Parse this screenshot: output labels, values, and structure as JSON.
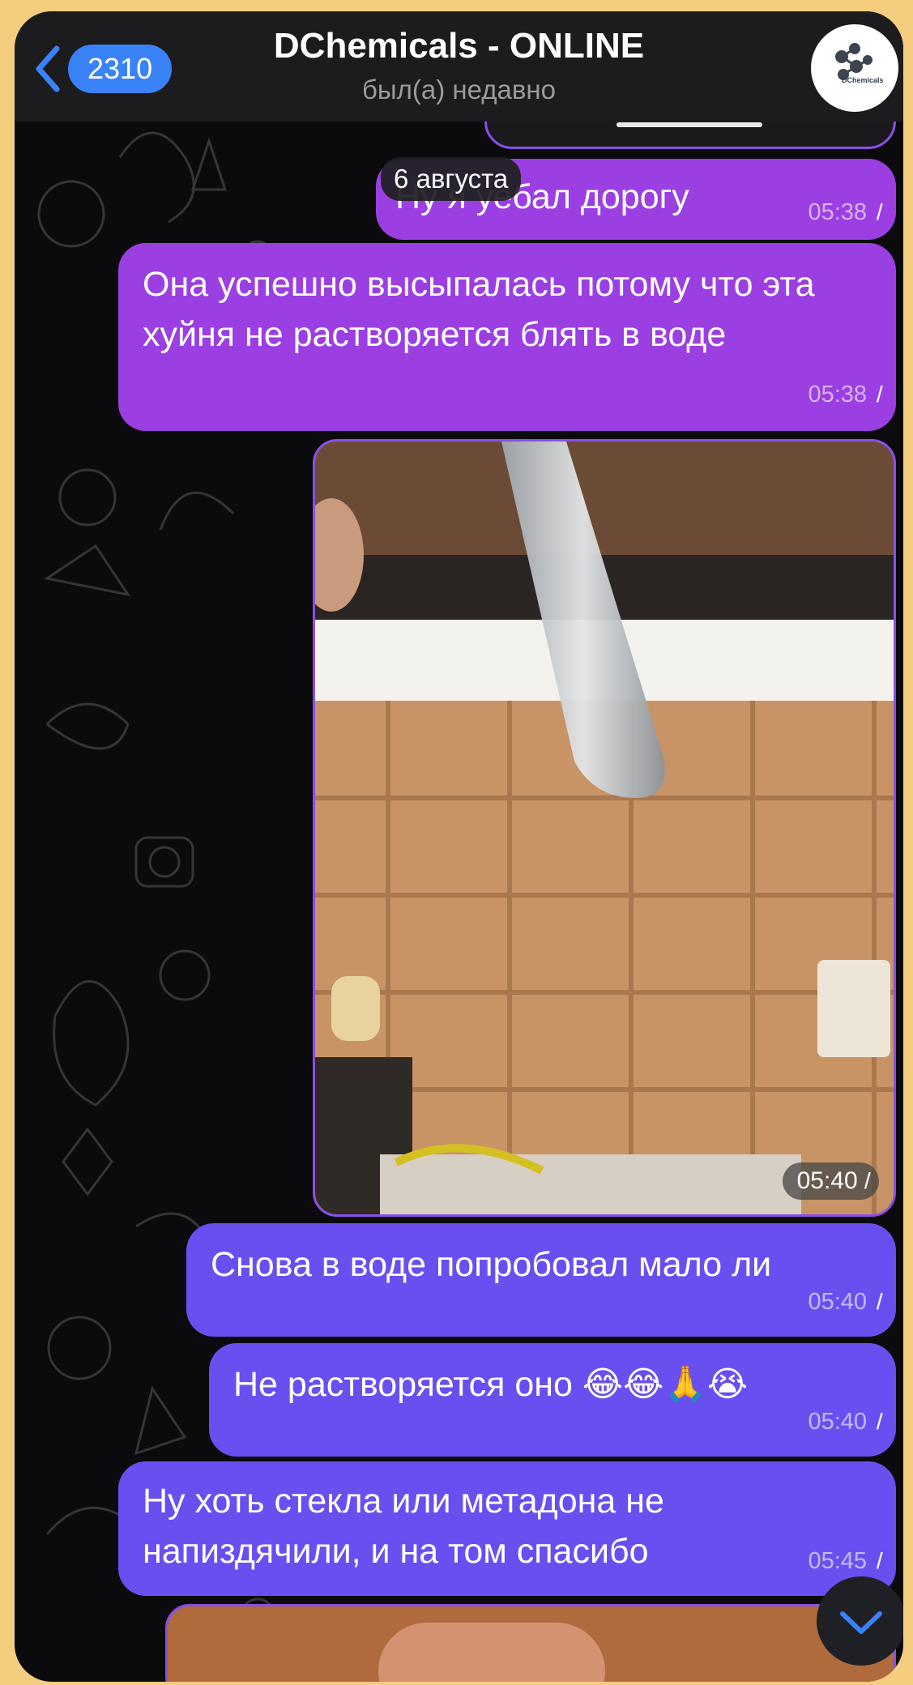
{
  "header": {
    "back_count": "2310",
    "title": "DChemicals - ONLINE",
    "subtitle": "был(а) недавно",
    "avatar_label": "DChemicals"
  },
  "date_divider": "6 августа",
  "messages": [
    {
      "text": "Ну я уебал дорогу",
      "time": "05:38",
      "color": "#9b3fe2"
    },
    {
      "text": "Она успешно высыпалась потому что эта хуйня не растворяется блять в воде",
      "time": "05:38",
      "color": "#9b3fe2"
    },
    {
      "type": "photo",
      "time": "05:40",
      "color": "#9b3fe2"
    },
    {
      "text": "Снова в воде попробовал мало ли",
      "time": "05:40",
      "color": "#6a4ff0"
    },
    {
      "text": "Не растворяется оно 😂😂🙏😭",
      "time": "05:40",
      "color": "#6a4ff0"
    },
    {
      "text": "Ну хоть стекла или метадона не напиздячили, и на том спасибо",
      "time": "05:45",
      "color": "#6a4ff0"
    }
  ],
  "checkmarks": "//",
  "colors": {
    "background": "#f4cd7f",
    "header": "#1c1c1e",
    "accent_blue": "#3a82f7"
  }
}
